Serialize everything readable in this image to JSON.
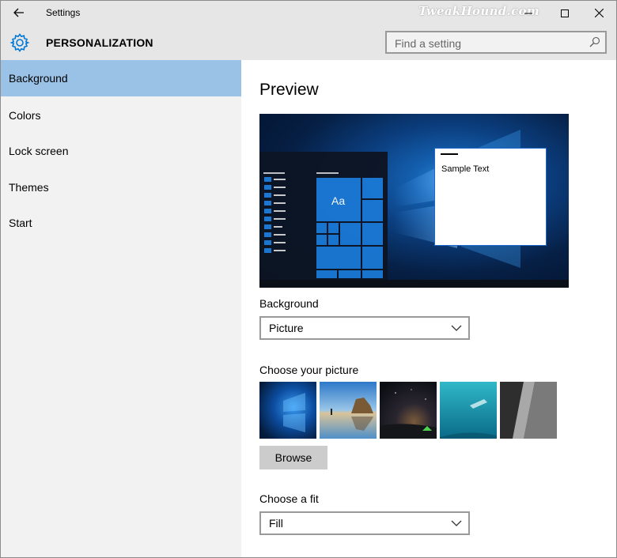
{
  "window": {
    "title": "Settings",
    "watermark": "TweakHound.com"
  },
  "header": {
    "section_title": "PERSONALIZATION",
    "search_placeholder": "Find a setting"
  },
  "sidebar": {
    "items": [
      {
        "label": "Background",
        "active": true
      },
      {
        "label": "Colors",
        "active": false
      },
      {
        "label": "Lock screen",
        "active": false
      },
      {
        "label": "Themes",
        "active": false
      },
      {
        "label": "Start",
        "active": false
      }
    ]
  },
  "main": {
    "preview_title": "Preview",
    "preview_tile_text": "Aa",
    "preview_sample_text": "Sample Text",
    "background_label": "Background",
    "background_value": "Picture",
    "choose_picture_label": "Choose your picture",
    "browse_label": "Browse",
    "fit_label": "Choose a fit",
    "fit_value": "Fill"
  },
  "thumbnails": [
    {
      "name": "windows-hero-blue"
    },
    {
      "name": "beach-rocks-reflection"
    },
    {
      "name": "night-sky-tent"
    },
    {
      "name": "underwater-swimmer"
    },
    {
      "name": "rock-cliff-gray"
    }
  ],
  "colors": {
    "accent": "#0078d7",
    "active_nav": "#99c2e6",
    "chrome": "#e6e6e6",
    "sidebar": "#f2f2f2"
  }
}
